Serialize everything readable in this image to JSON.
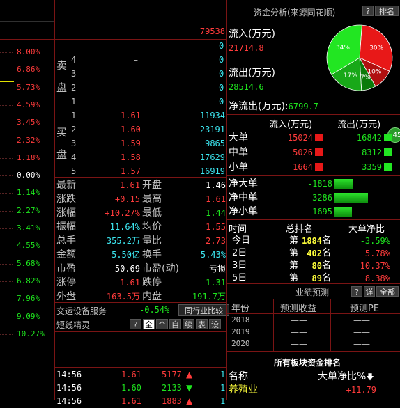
{
  "left_pct_axis": [
    "8.00%",
    "6.86%",
    "5.73%",
    "4.59%",
    "3.45%",
    "2.32%",
    "1.18%",
    "0.00%",
    "1.14%",
    "2.27%",
    "3.41%",
    "4.55%",
    "5.68%",
    "6.82%",
    "7.96%",
    "9.09%",
    "10.27%"
  ],
  "order_book": {
    "header_total": "79538",
    "sell_label_chars": [
      "卖",
      "盘"
    ],
    "buy_label_chars": [
      "买",
      "盘"
    ],
    "sell_zero_top": "0",
    "sells": [
      {
        "level": "4",
        "price": "–",
        "vol": "0"
      },
      {
        "level": "3",
        "price": "–",
        "vol": "0"
      },
      {
        "level": "2",
        "price": "–",
        "vol": "0"
      },
      {
        "level": "1",
        "price": "–",
        "vol": "0"
      }
    ],
    "buys": [
      {
        "level": "1",
        "price": "1.61",
        "vol": "11934"
      },
      {
        "level": "2",
        "price": "1.60",
        "vol": "23191"
      },
      {
        "level": "3",
        "price": "1.59",
        "vol": "9865"
      },
      {
        "level": "4",
        "price": "1.58",
        "vol": "17629"
      },
      {
        "level": "5",
        "price": "1.57",
        "vol": "16919"
      }
    ]
  },
  "quote": [
    {
      "l1": "最新",
      "v1": "1.61",
      "c1": "red",
      "l2": "开盘",
      "v2": "1.46",
      "c2": "white"
    },
    {
      "l1": "涨跌",
      "v1": "+0.15",
      "c1": "red",
      "l2": "最高",
      "v2": "1.61",
      "c2": "red"
    },
    {
      "l1": "涨幅",
      "v1": "+10.27%",
      "c1": "red",
      "l2": "最低",
      "v2": "1.44",
      "c2": "green"
    },
    {
      "l1": "振幅",
      "v1": "11.64%",
      "c1": "cyan",
      "l2": "均价",
      "v2": "1.55",
      "c2": "red"
    },
    {
      "l1": "总手",
      "v1": "355.2万",
      "c1": "cyan",
      "l2": "量比",
      "v2": "2.73",
      "c2": "red"
    },
    {
      "l1": "金额",
      "v1": "5.50亿",
      "c1": "cyan",
      "l2": "换手",
      "v2": "5.43%",
      "c2": "cyan"
    },
    {
      "l1": "市盈",
      "v1": "50.69",
      "c1": "white",
      "l2": "市盈(动)",
      "v2": "亏损",
      "c2": "white"
    },
    {
      "l1": "涨停",
      "v1": "1.61",
      "c1": "red",
      "l2": "跌停",
      "v2": "1.31",
      "c2": "green"
    },
    {
      "l1": "外盘",
      "v1": "163.5万",
      "c1": "red",
      "l2": "内盘",
      "v2": "191.7万",
      "c2": "green"
    }
  ],
  "exchange_row": {
    "label": "交运设备服务",
    "value": "-0.54%",
    "compare_btn": "同行业比较"
  },
  "short_sprite": {
    "label": "短线精灵",
    "buttons": [
      "?",
      "全",
      "个",
      "自",
      "续",
      "表",
      "设"
    ]
  },
  "ticks": [
    {
      "time": "14:56",
      "price": "1.61",
      "vol": "5177",
      "dir": "up",
      "tail": "1"
    },
    {
      "time": "14:56",
      "price": "1.60",
      "vol": "2133",
      "dir": "down",
      "tail": "1"
    },
    {
      "time": "14:56",
      "price": "1.61",
      "vol": "1883",
      "dir": "up",
      "tail": "1"
    }
  ],
  "fund": {
    "title": "资金分析(来源同花顺)",
    "help_btn": "?",
    "rank_btn": "排名",
    "inflow_label": "流入(万元)",
    "inflow_value": "21714.8",
    "outflow_label": "流出(万元)",
    "outflow_value": "28514.6",
    "net_label": "净流出(万元):",
    "net_value": "6799.7",
    "pie": {
      "slices": [
        {
          "label": "30%",
          "value": 30,
          "color": "#e81818"
        },
        {
          "label": "10%",
          "value": 10,
          "color": "#b01010"
        },
        {
          "label": "7%",
          "value": 7,
          "color": "#0a7a0a"
        },
        {
          "label": "17%",
          "value": 17,
          "color": "#18a818"
        },
        {
          "label": "34%",
          "value": 34,
          "color": "#22e622"
        }
      ]
    },
    "table_head": {
      "in": "流入(万元)",
      "out": "流出(万元)"
    },
    "table_rows": [
      {
        "label": "大单",
        "in": "15024",
        "out": "16842"
      },
      {
        "label": "中单",
        "in": "5026",
        "out": "8312"
      },
      {
        "label": "小单",
        "in": "1664",
        "out": "3359"
      }
    ],
    "side_badge": "45",
    "net_rows": [
      {
        "label": "净大单",
        "value": "-1818",
        "bar": 0.38
      },
      {
        "label": "净中单",
        "value": "-3286",
        "bar": 0.68
      },
      {
        "label": "净小单",
        "value": "-1695",
        "bar": 0.35
      }
    ],
    "rank_head": {
      "time": "时间",
      "rank": "总排名",
      "net": "大单净比"
    },
    "rank_rows": [
      {
        "time": "今日",
        "pre": "第",
        "rank": "1884",
        "post": "名",
        "net": "-3.59%",
        "net_color": "green"
      },
      {
        "time": "2日",
        "pre": "第",
        "rank": "402",
        "post": "名",
        "net": "5.78%",
        "net_color": "red"
      },
      {
        "time": "3日",
        "pre": "第",
        "rank": "80",
        "post": "名",
        "net": "10.37%",
        "net_color": "red"
      },
      {
        "time": "5日",
        "pre": "第",
        "rank": "89",
        "post": "名",
        "net": "8.38%",
        "net_color": "red"
      }
    ]
  },
  "forecast": {
    "title": "业绩预测",
    "help_btn": "?",
    "detail_btn": "详",
    "all_btn": "全部",
    "cols": {
      "year": "年份",
      "income": "预测收益",
      "pe": "预测PE"
    },
    "rows": [
      {
        "year": "2018",
        "income": "——",
        "pe": "——"
      },
      {
        "year": "2019",
        "income": "——",
        "pe": "——"
      },
      {
        "year": "2020",
        "income": "——",
        "pe": "——"
      }
    ]
  },
  "sector": {
    "title": "所有板块资金排名",
    "col_name": "名称",
    "col_net": "大单净比%",
    "rows": [
      {
        "name": "养殖业",
        "net": "+11.79"
      }
    ]
  }
}
